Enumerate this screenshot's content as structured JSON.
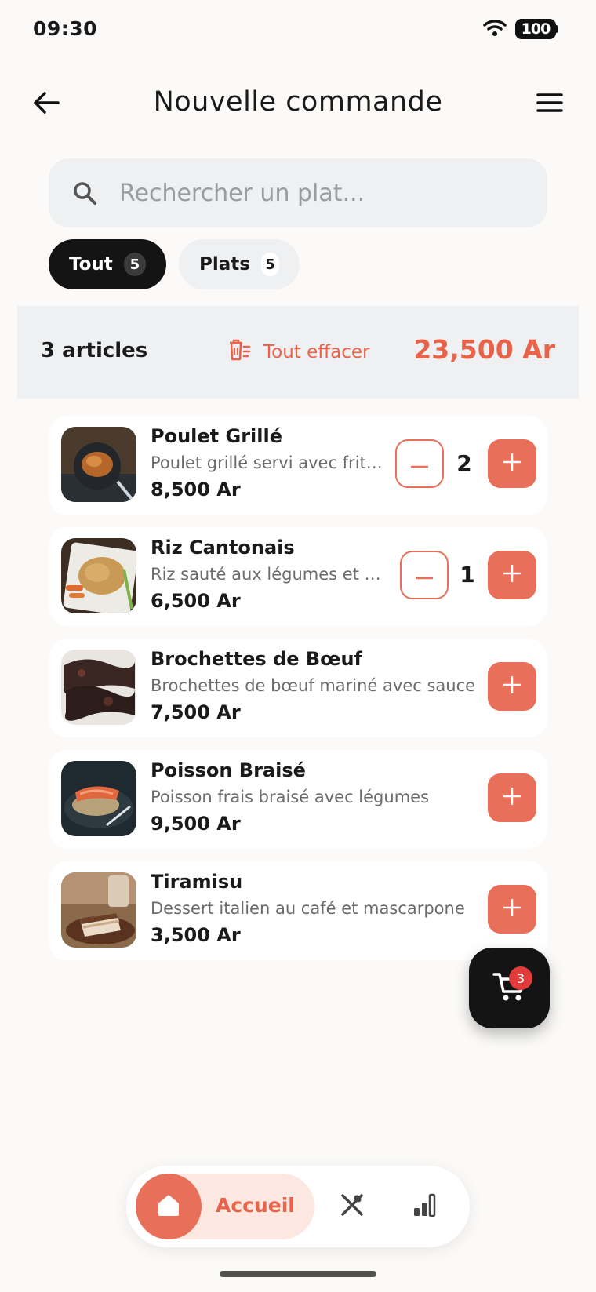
{
  "status_bar": {
    "time": "09:30",
    "battery": "100"
  },
  "header": {
    "title": "Nouvelle commande",
    "back_icon": "arrow-left-icon",
    "menu_icon": "hamburger-menu-icon"
  },
  "search": {
    "placeholder": "Rechercher un plat..."
  },
  "filters": [
    {
      "label": "Tout",
      "count": "5",
      "active": true
    },
    {
      "label": "Plats",
      "count": "5",
      "active": false
    }
  ],
  "summary": {
    "count_label": "3 articles",
    "clear_label": "Tout effacer",
    "total": "23,500 Ar"
  },
  "items": [
    {
      "name": "Poulet Grillé",
      "description": "Poulet grillé servi avec frites",
      "price": "8,500 Ar",
      "quantity": "2"
    },
    {
      "name": "Riz Cantonais",
      "description": "Riz sauté aux légumes et crevettes",
      "price": "6,500 Ar",
      "quantity": "1"
    },
    {
      "name": "Brochettes de Bœuf",
      "description": "Brochettes de bœuf mariné avec sauce",
      "price": "7,500 Ar",
      "quantity": ""
    },
    {
      "name": "Poisson Braisé",
      "description": "Poisson frais braisé avec légumes",
      "price": "9,500 Ar",
      "quantity": ""
    },
    {
      "name": "Tiramisu",
      "description": "Dessert italien au café et mascarpone",
      "price": "3,500 Ar",
      "quantity": ""
    }
  ],
  "cart": {
    "badge": "3"
  },
  "bottom_nav": {
    "home_label": "Accueil"
  },
  "colors": {
    "accent": "#e8705a",
    "accent_text": "#e8634a",
    "dark": "#141414",
    "surface": "#eef0f2"
  }
}
